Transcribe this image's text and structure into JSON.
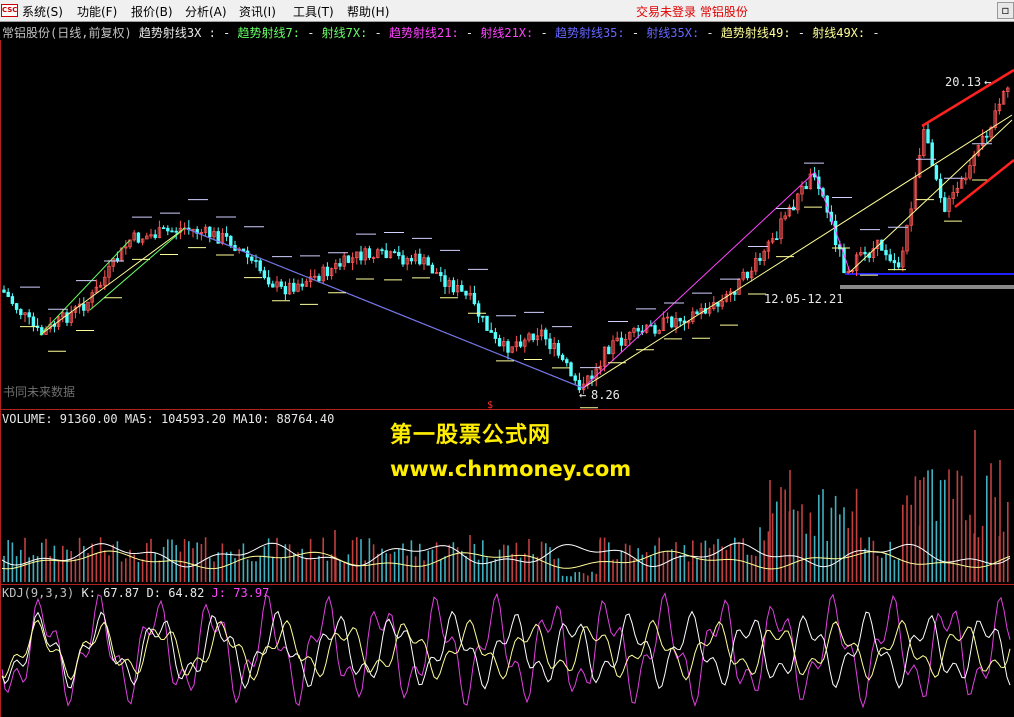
{
  "menu": {
    "logo": "CSC",
    "items": [
      "系统(S)",
      "功能(F)",
      "报价(B)",
      "分析(A)",
      "资讯(I)",
      "工具(T)",
      "帮助(H)"
    ],
    "status": "交易未登录  常铝股份"
  },
  "main_panel": {
    "title": "常铝股份(日线,前复权)",
    "legend": [
      {
        "text": "趋势射线3X :",
        "color": "#e8e8e8"
      },
      {
        "text": "-",
        "color": "#e8e8e8"
      },
      {
        "text": "趋势射线7:",
        "color": "#66ff66"
      },
      {
        "text": "-",
        "color": "#e8e8e8"
      },
      {
        "text": "射线7X:",
        "color": "#66ff66"
      },
      {
        "text": "-",
        "color": "#e8e8e8"
      },
      {
        "text": "趋势射线21:",
        "color": "#ff44ff"
      },
      {
        "text": "-",
        "color": "#e8e8e8"
      },
      {
        "text": "射线21X:",
        "color": "#ff44ff"
      },
      {
        "text": "-",
        "color": "#e8e8e8"
      },
      {
        "text": "趋势射线35:",
        "color": "#6666ff"
      },
      {
        "text": "-",
        "color": "#e8e8e8"
      },
      {
        "text": "射线35X:",
        "color": "#6666ff"
      },
      {
        "text": "-",
        "color": "#e8e8e8"
      },
      {
        "text": "趋势射线49:",
        "color": "#ffff99"
      },
      {
        "text": "-",
        "color": "#e8e8e8"
      },
      {
        "text": "射线49X:",
        "color": "#ffff99"
      },
      {
        "text": "-",
        "color": "#e8e8e8"
      }
    ],
    "high_label": "20.13",
    "low_label": "8.26",
    "range_label": "12.05-12.21",
    "corner_text": "书同未来数据",
    "marker": "$"
  },
  "volume_panel": {
    "header": [
      {
        "text": "VOLUME: 91360.00",
        "color": "#e8e8e8"
      },
      {
        "text": "MA5: 104593.20",
        "color": "#e8e8e8"
      },
      {
        "text": "MA10: 88764.40",
        "color": "#e8e8e8"
      }
    ]
  },
  "kdj_panel": {
    "header": [
      {
        "text": "KDJ(9,3,3)",
        "color": "#c0c0c0"
      },
      {
        "text": "K: 67.87",
        "color": "#e8e8e8"
      },
      {
        "text": "D: 64.82",
        "color": "#e8e8e8"
      },
      {
        "text": "J: 73.97",
        "color": "#ff44ff"
      }
    ]
  },
  "watermark": {
    "title": "第一股票公式网",
    "url": "www.chnmoney.com"
  },
  "colors": {
    "up": "#ff5555",
    "down": "#55ffff",
    "accent_red": "#ff2020",
    "support_blue": "#2020ff"
  }
}
